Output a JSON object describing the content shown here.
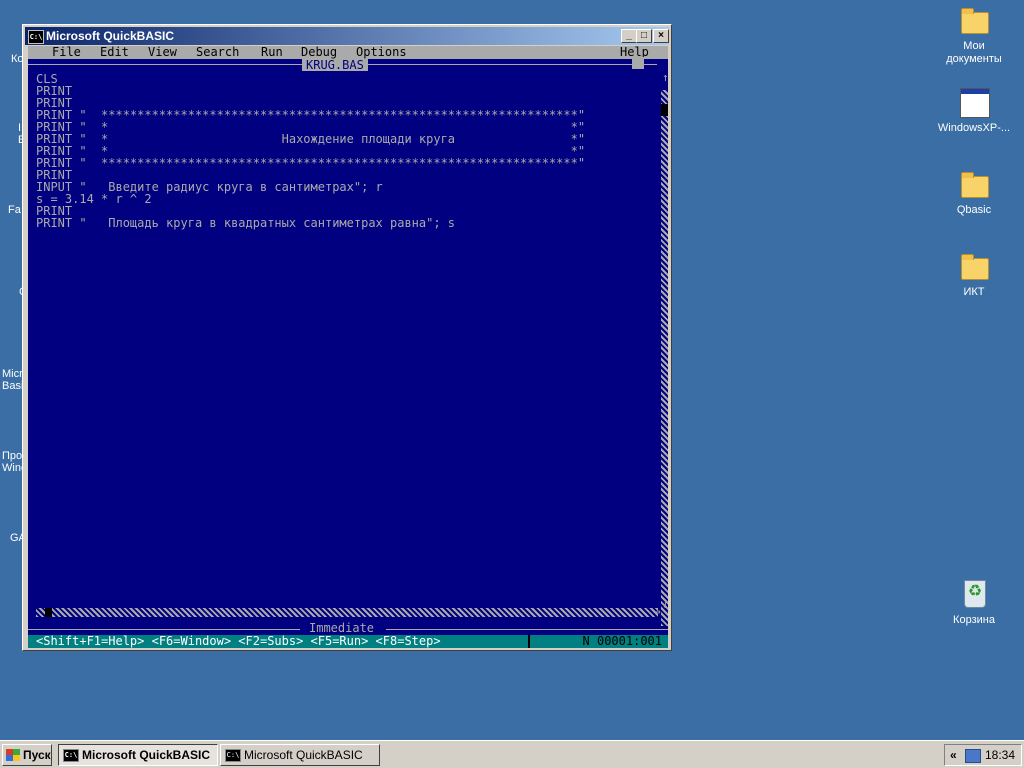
{
  "desktop": {
    "icons_right": [
      {
        "label": "Мои документы"
      },
      {
        "label": "WindowsXP-..."
      },
      {
        "label": "Qbasic"
      },
      {
        "label": "ИКТ"
      },
      {
        "label": "Корзина"
      }
    ],
    "edge_fragments": [
      "Ко",
      "I",
      "Е",
      "Fa",
      "С",
      "Micro",
      "Basi",
      "Про",
      "Wind",
      "GA"
    ]
  },
  "window": {
    "title": "Microsoft QuickBASIC",
    "controls": {
      "minimize": "_",
      "maximize": "□",
      "close": "×"
    }
  },
  "qb": {
    "menu": [
      "File",
      "Edit",
      "View",
      "Search",
      "Run",
      "Debug",
      "Options",
      "Help"
    ],
    "document_title": "KRUG.BAS",
    "code_lines": [
      "CLS",
      "PRINT",
      "PRINT",
      "PRINT \"  ******************************************************************\"",
      "PRINT \"  *                                                                *\"",
      "PRINT \"  *                        Нахождение площади круга                *\"",
      "PRINT \"  *                                                                *\"",
      "PRINT \"  ******************************************************************\"",
      "PRINT",
      "INPUT \"   Введите радиус круга в сантиметрах\"; r",
      "s = 3.14 * r ^ 2",
      "PRINT",
      "PRINT \"   Площадь круга в квадратных сантиметрах равна\"; s"
    ],
    "immediate_title": "Immediate",
    "status_hint": "<Shift+F1=Help> <F6=Window> <F2=Subs> <F5=Run> <F8=Step>",
    "status_position": "N 00001:001"
  },
  "taskbar": {
    "start_label": "Пуск",
    "buttons": [
      {
        "label": "Microsoft QuickBASIC",
        "active": true
      },
      {
        "label": "Microsoft QuickBASIC",
        "active": false
      }
    ],
    "tray_chevron": "«",
    "clock": "18:34"
  }
}
